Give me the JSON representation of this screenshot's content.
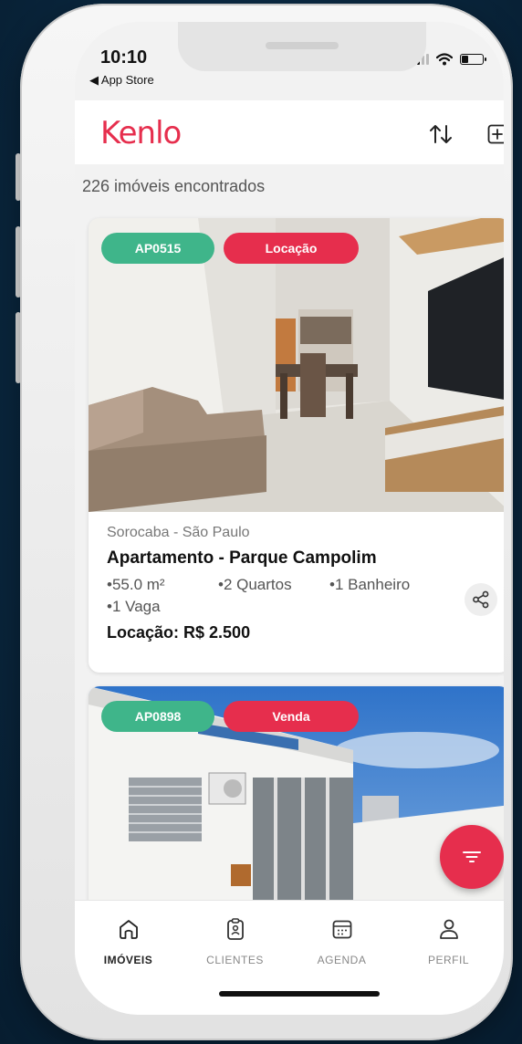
{
  "status": {
    "time": "10:10",
    "back_label": "◀ App Store"
  },
  "header": {
    "logo": "Kenlo"
  },
  "results": {
    "count_text": "226 imóveis encontrados"
  },
  "listings": [
    {
      "code": "AP0515",
      "type": "Locação",
      "location": "Sorocaba - São Paulo",
      "title": "Apartamento - Parque Campolim",
      "features": [
        "•55.0 m²",
        "•2 Quartos",
        "•1 Banheiro",
        "•1 Vaga"
      ],
      "price": "Locação: R$ 2.500"
    },
    {
      "code": "AP0898",
      "type": "Venda"
    }
  ],
  "tabs": [
    {
      "label": "IMÓVEIS",
      "icon": "home-icon",
      "active": true
    },
    {
      "label": "CLIENTES",
      "icon": "clipboard-icon",
      "active": false
    },
    {
      "label": "AGENDA",
      "icon": "calendar-icon",
      "active": false
    },
    {
      "label": "PERFIL",
      "icon": "user-icon",
      "active": false
    }
  ],
  "colors": {
    "brand": "#e62e4d",
    "code_badge": "#3fb58a"
  }
}
